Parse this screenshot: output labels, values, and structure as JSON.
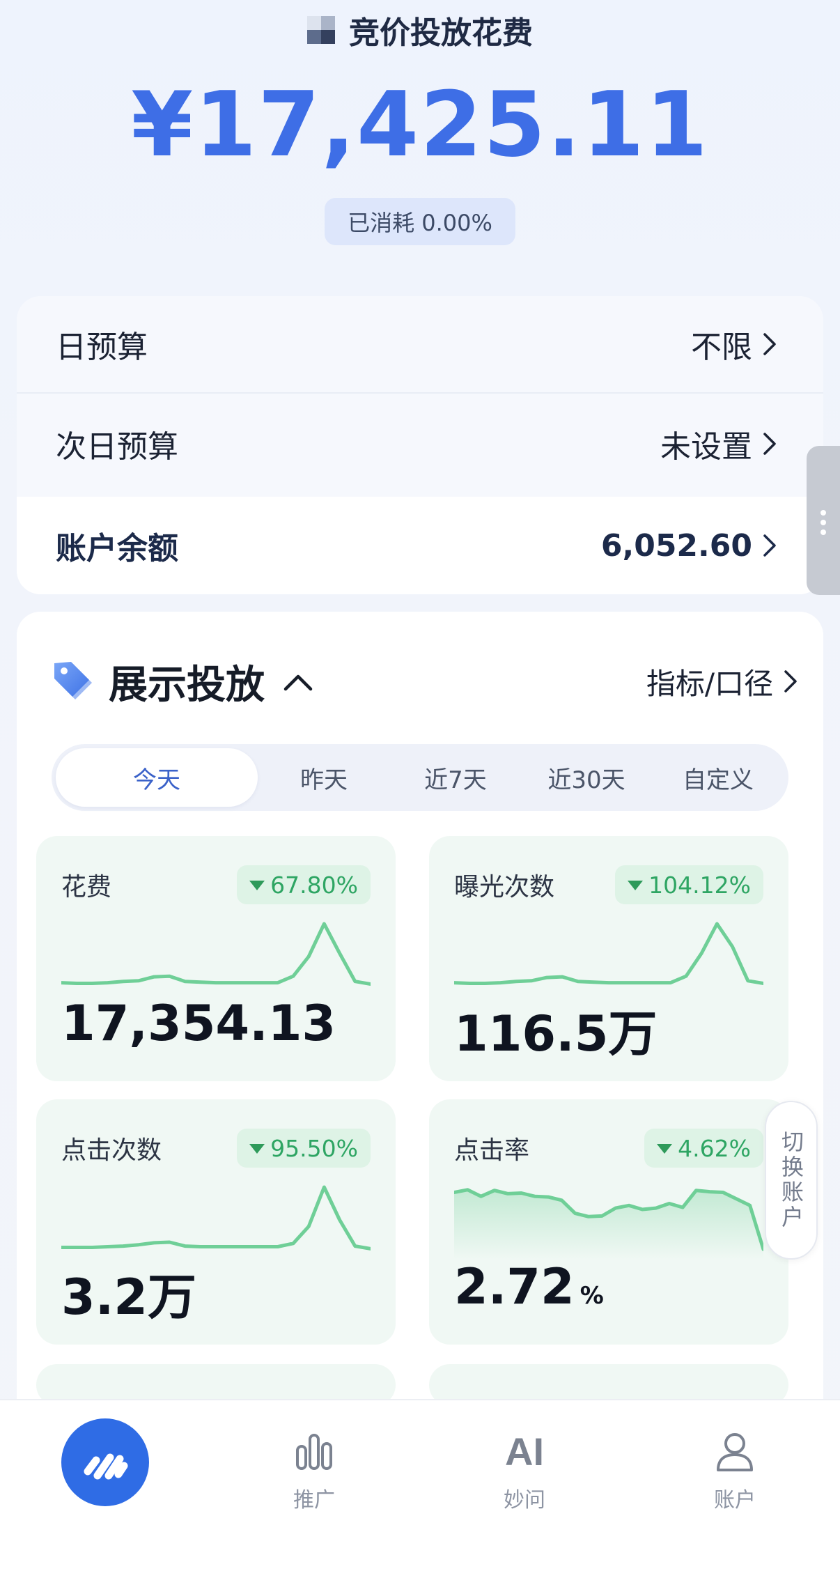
{
  "header": {
    "title": "竞价投放花费",
    "amount": "¥17,425.11",
    "consumed": "已消耗 0.00%"
  },
  "budget": {
    "rows": [
      {
        "label": "日预算",
        "value": "不限"
      },
      {
        "label": "次日预算",
        "value": "未设置"
      },
      {
        "label": "账户余额",
        "value": "6,052.60"
      }
    ]
  },
  "section": {
    "title": "展示投放",
    "link": "指标/口径",
    "icon": "price-tag-icon"
  },
  "tabs": [
    {
      "label": "今天",
      "active": true
    },
    {
      "label": "昨天",
      "active": false
    },
    {
      "label": "近7天",
      "active": false
    },
    {
      "label": "近30天",
      "active": false
    },
    {
      "label": "自定义",
      "active": false
    }
  ],
  "metrics": [
    {
      "label": "花费",
      "change": "67.80%",
      "value": "17,354.13",
      "unit": "",
      "trend": [
        0.1,
        0.09,
        0.09,
        0.1,
        0.12,
        0.13,
        0.19,
        0.2,
        0.12,
        0.11,
        0.1,
        0.1,
        0.1,
        0.1,
        0.1,
        0.2,
        0.5,
        1.0,
        0.55,
        0.12,
        0.08
      ]
    },
    {
      "label": "曝光次数",
      "change": "104.12%",
      "value": "116.5万",
      "unit": "",
      "trend": [
        0.1,
        0.09,
        0.09,
        0.1,
        0.12,
        0.13,
        0.18,
        0.19,
        0.12,
        0.11,
        0.1,
        0.1,
        0.1,
        0.1,
        0.1,
        0.2,
        0.55,
        1.0,
        0.65,
        0.13,
        0.09
      ]
    },
    {
      "label": "点击次数",
      "change": "95.50%",
      "value": "3.2万",
      "unit": "",
      "trend": [
        0.08,
        0.08,
        0.08,
        0.09,
        0.1,
        0.12,
        0.15,
        0.16,
        0.1,
        0.09,
        0.09,
        0.09,
        0.09,
        0.09,
        0.09,
        0.14,
        0.4,
        1.0,
        0.5,
        0.1,
        0.06
      ]
    },
    {
      "label": "点击率",
      "change": "4.62%",
      "value": "2.72",
      "unit": "%",
      "trend": [
        0.92,
        0.96,
        0.86,
        0.95,
        0.9,
        0.91,
        0.86,
        0.85,
        0.8,
        0.6,
        0.55,
        0.56,
        0.68,
        0.72,
        0.66,
        0.68,
        0.75,
        0.69,
        0.95,
        0.93,
        0.92,
        0.82,
        0.72,
        0.05
      ]
    },
    {
      "label": "",
      "change": "",
      "value": "",
      "unit": "",
      "trend": []
    },
    {
      "label": "",
      "change": "",
      "value": "",
      "unit": "",
      "trend": []
    }
  ],
  "switch_account": "切换账户",
  "nav": {
    "home_icon": "home-logo-icon",
    "items": [
      {
        "label": "推广",
        "icon": "bar-chart-icon"
      },
      {
        "label": "妙问",
        "icon": "ai-icon",
        "glyph": "AI"
      },
      {
        "label": "账户",
        "icon": "user-icon"
      }
    ]
  },
  "colors": {
    "accent": "#3e6ee6",
    "positive": "#2ea563",
    "spark_line": "#6fcf97",
    "nav_home": "#2f6ce5"
  }
}
